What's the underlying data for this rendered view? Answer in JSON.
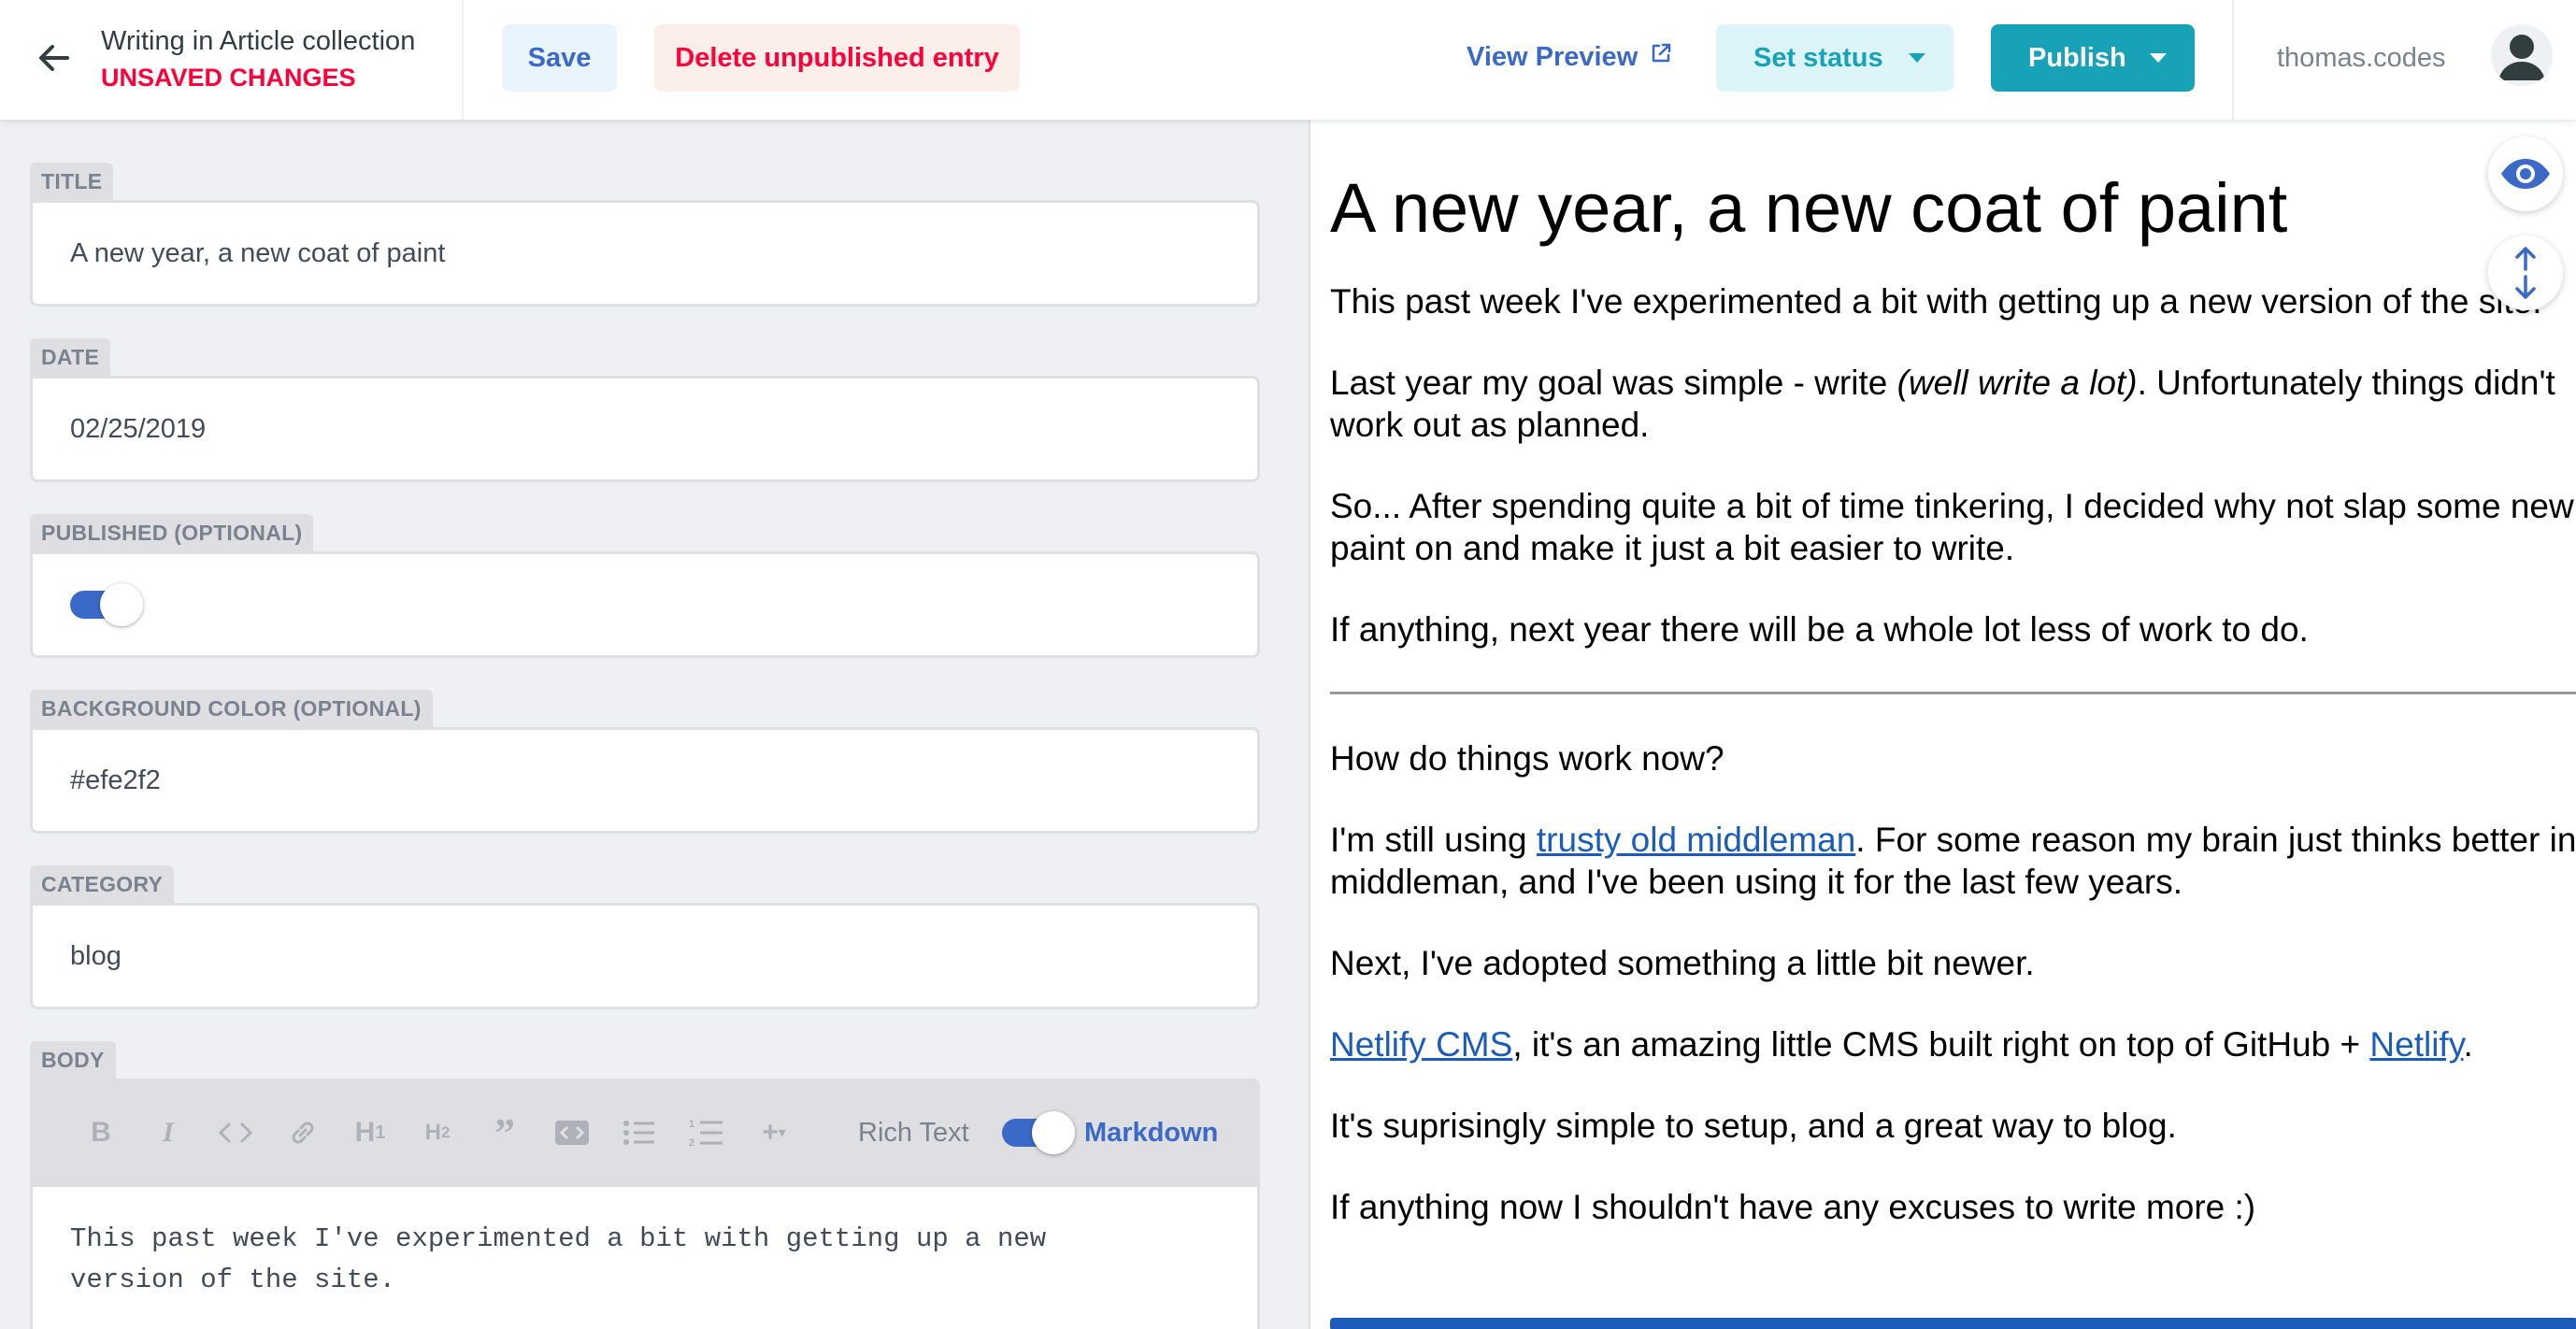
{
  "header": {
    "collection": "Writing in Article collection",
    "unsaved": "UNSAVED CHANGES",
    "save": "Save",
    "delete": "Delete unpublished entry",
    "view_preview": "View Preview",
    "set_status": "Set status",
    "publish": "Publish",
    "user": "thomas.codes"
  },
  "fields": {
    "title": {
      "label": "TITLE",
      "value": "A new year, a new coat of paint"
    },
    "date": {
      "label": "DATE",
      "value": "02/25/2019"
    },
    "published": {
      "label": "PUBLISHED (OPTIONAL)",
      "value": true
    },
    "bg_color": {
      "label": "BACKGROUND COLOR (OPTIONAL)",
      "value": "#efe2f2"
    },
    "category": {
      "label": "CATEGORY",
      "value": "blog"
    },
    "body": {
      "label": "BODY",
      "mode_rich": "Rich Text",
      "mode_markdown": "Markdown",
      "text": "This past week I've experimented a bit with getting up a new\nversion of the site."
    }
  },
  "toolbar_icons": [
    "bold-icon",
    "italic-icon",
    "code-icon",
    "link-icon",
    "heading-1-icon",
    "heading-2-icon",
    "quote-icon",
    "code-block-icon",
    "bulleted-list-icon",
    "numbered-list-icon",
    "add-component-icon"
  ],
  "preview": {
    "title": "A new year, a new coat of paint",
    "p1": "This past week I've experimented a bit with getting up a new version of the site.",
    "p2a": "Last year my goal was simple - write ",
    "p2em": "(well write a lot)",
    "p2b": ". Unfortunately things didn't work out as planned.",
    "p3": "So... After spending quite a bit of time tinkering, I decided why not slap some new paint on and make it just a bit easier to write.",
    "p4": "If anything, next year there will be a whole lot less of work to do.",
    "p5": "How do things work now?",
    "p6a": "I'm still using ",
    "p6link": "trusty old middleman",
    "p6b": ". For some reason my brain just thinks better in middleman, and I've been using it for the last few years.",
    "p7": "Next, I've adopted something a little bit newer.",
    "p8link1": "Netlify CMS",
    "p8a": ", it's an amazing little CMS built right on top of GitHub + ",
    "p8link2": "Netlify",
    "p8b": ".",
    "p9": "It's suprisingly simple to setup, and a great way to blog.",
    "p10": "If anything now I shouldn't have any excuses to write more :)"
  },
  "colors": {
    "accent": "#3a69c7",
    "danger": "#ff003b",
    "teal": "#17a2b8"
  }
}
